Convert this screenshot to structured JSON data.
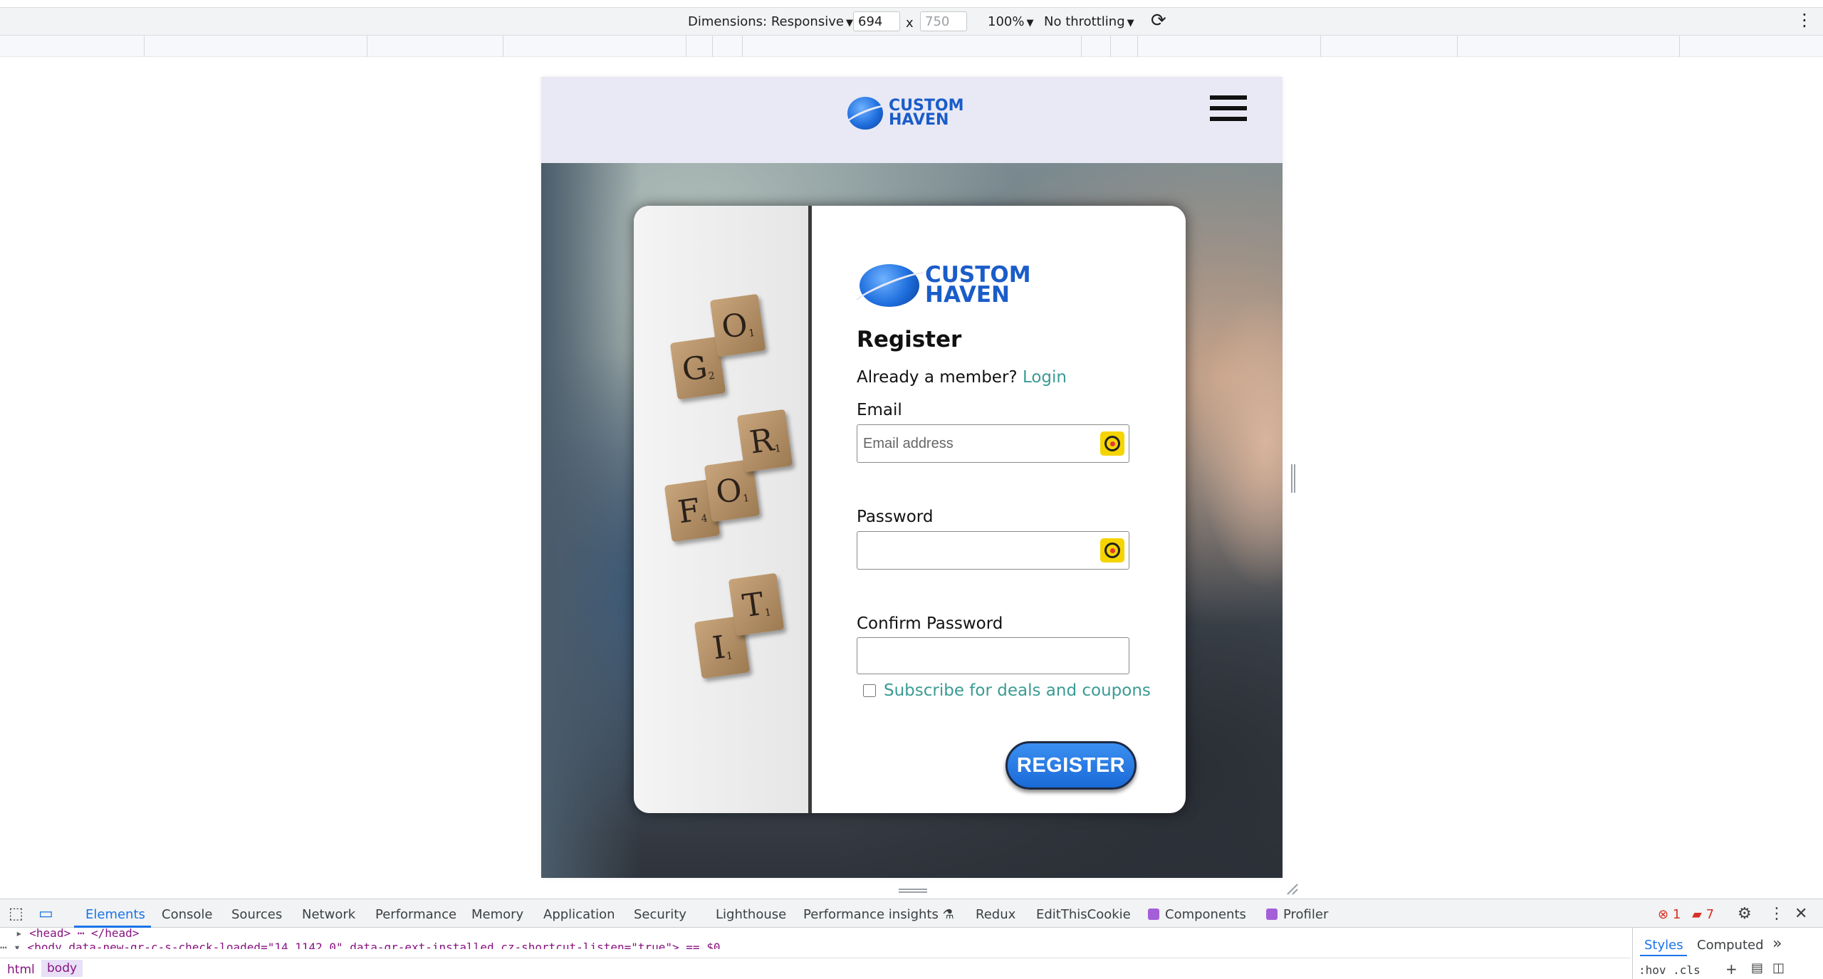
{
  "device_toolbar": {
    "dimensions_label": "Dimensions: Responsive",
    "width_value": "694",
    "times": "x",
    "height_placeholder": "750",
    "zoom": "100%",
    "throttling": "No throttling",
    "more_icon": "more-vertical-icon",
    "rotate_icon": "rotate-icon"
  },
  "site": {
    "header_logo_line1": "CUSTOM",
    "header_logo_line2": "HAVEN",
    "menu_icon": "hamburger-menu-icon"
  },
  "card_image": {
    "tiles": [
      {
        "letter": "G",
        "sub": "2"
      },
      {
        "letter": "O",
        "sub": "1"
      },
      {
        "letter": "F",
        "sub": "4"
      },
      {
        "letter": "O",
        "sub": "1"
      },
      {
        "letter": "R",
        "sub": "1"
      },
      {
        "letter": "I",
        "sub": "1"
      },
      {
        "letter": "T",
        "sub": "1"
      }
    ]
  },
  "register_form": {
    "logo_line1": "CUSTOM",
    "logo_line2": "HAVEN",
    "title": "Register",
    "already_member_text": "Already a member?",
    "login_link": "Login",
    "email_label": "Email",
    "email_placeholder": "Email address",
    "email_value": "",
    "password_label": "Password",
    "password_value": "",
    "confirm_password_label": "Confirm Password",
    "confirm_password_value": "",
    "subscribe_label": "Subscribe for deals and coupons",
    "subscribe_checked": false,
    "register_button": "REGISTER",
    "accent_color": "#1a6ad8",
    "link_color": "#3a9b94"
  },
  "devtools": {
    "tabs": [
      "Elements",
      "Console",
      "Sources",
      "Network",
      "Performance",
      "Memory",
      "Application",
      "Security",
      "Lighthouse",
      "Performance insights",
      "Redux",
      "EditThisCookie",
      "Components",
      "Profiler"
    ],
    "active_tab": "Elements",
    "errors_count": "1",
    "warnings_count": "7",
    "code_line1": "<head> ⋯ </head>",
    "code_line2": "<body data-new-gr-c-s-check-loaded=\"14.1142.0\" data-gr-ext-installed cz-shortcut-listen=\"true\"> == $0",
    "breadcrumbs": [
      "html",
      "body"
    ],
    "side_tabs": [
      "Styles",
      "Computed"
    ],
    "side_active": "Styles",
    "styles_filter": ":hov .cls"
  }
}
